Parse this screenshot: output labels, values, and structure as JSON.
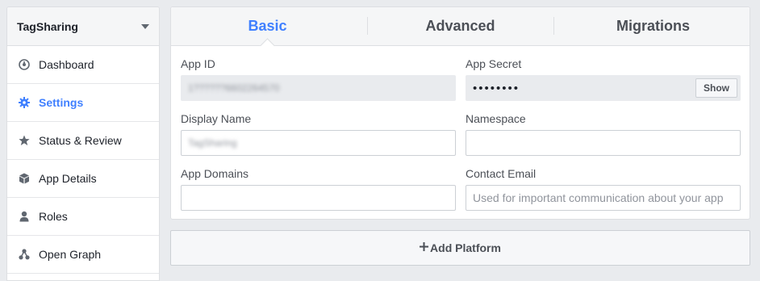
{
  "sidebar": {
    "app_name": "TagSharing",
    "items": [
      {
        "label": "Dashboard",
        "icon": "dashboard-icon",
        "active": false
      },
      {
        "label": "Settings",
        "icon": "gear-icon",
        "active": true
      },
      {
        "label": "Status & Review",
        "icon": "star-icon",
        "active": false
      },
      {
        "label": "App Details",
        "icon": "cube-icon",
        "active": false
      },
      {
        "label": "Roles",
        "icon": "person-icon",
        "active": false
      },
      {
        "label": "Open Graph",
        "icon": "graph-nodes-icon",
        "active": false
      }
    ]
  },
  "tabs": [
    {
      "label": "Basic",
      "active": true
    },
    {
      "label": "Advanced",
      "active": false
    },
    {
      "label": "Migrations",
      "active": false
    }
  ],
  "form": {
    "app_id": {
      "label": "App ID",
      "value": "1??????6602264570"
    },
    "app_secret": {
      "label": "App Secret",
      "value": "••••••••",
      "show_label": "Show"
    },
    "display_name": {
      "label": "Display Name",
      "value": "TagSharing"
    },
    "namespace": {
      "label": "Namespace",
      "value": ""
    },
    "app_domains": {
      "label": "App Domains",
      "value": ""
    },
    "contact_email": {
      "label": "Contact Email",
      "value": "",
      "placeholder": "Used for important communication about your app"
    }
  },
  "add_platform": {
    "label": "Add Platform"
  },
  "colors": {
    "accent": "#4080ff",
    "background": "#e9ebee",
    "text": "#4b4f56"
  }
}
